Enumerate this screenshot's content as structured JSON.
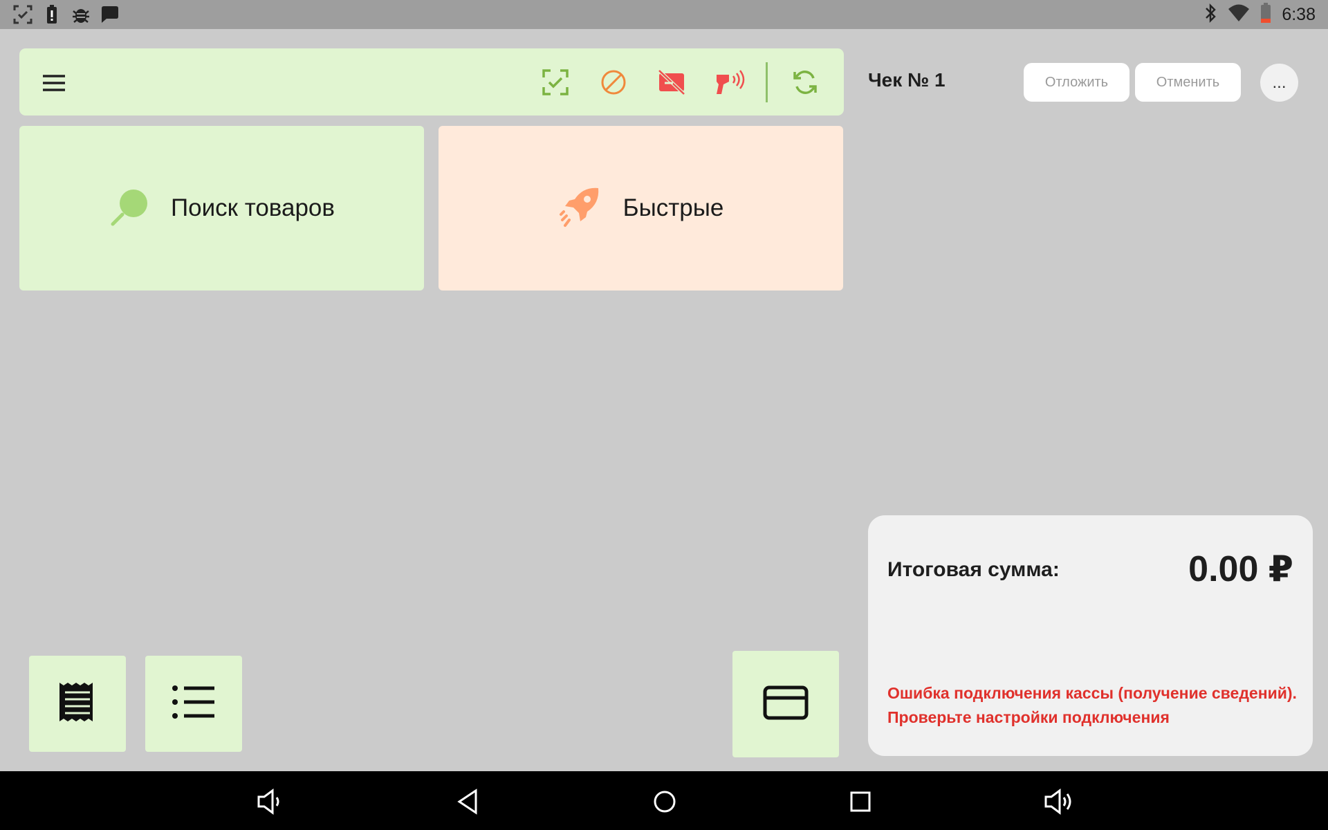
{
  "status_bar": {
    "time": "6:38",
    "left_icons": [
      "screenshot-icon",
      "battery-alert-icon",
      "bug-icon",
      "chat-icon"
    ],
    "right_icons": [
      "bluetooth-icon",
      "wifi-icon",
      "battery-low-icon"
    ]
  },
  "toolbar": {
    "icons": [
      "scan-check-icon",
      "forbidden-icon",
      "printer-disabled-icon",
      "barcode-scanner-icon",
      "sync-icon"
    ],
    "colors": {
      "green": "#7cb342",
      "orange": "#f0893c",
      "red": "#f04e4e"
    }
  },
  "tiles": {
    "search": {
      "label": "Поиск товаров",
      "icon": "search-icon"
    },
    "fast": {
      "label": "Быстрые",
      "icon": "rocket-icon"
    }
  },
  "receipt": {
    "title": "Чек № 1",
    "postpone_label": "Отложить",
    "cancel_label": "Отменить",
    "more_label": "..."
  },
  "summary": {
    "label": "Итоговая сумма:",
    "value": "0.00 ₽",
    "error": "Ошибка подключения кассы (получение сведений). Проверьте настройки подключения"
  },
  "bottom_buttons": [
    "receipt-icon",
    "list-icon",
    "card-icon"
  ],
  "nav_bar": [
    "volume-down-icon",
    "back-icon",
    "home-icon",
    "recents-icon",
    "volume-up-icon"
  ]
}
